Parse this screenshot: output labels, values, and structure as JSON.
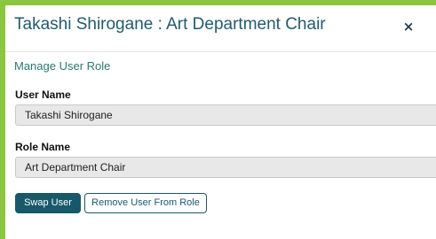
{
  "dialog": {
    "title": "Takashi Shirogane : Art Department Chair",
    "close_label": "×"
  },
  "section": {
    "title": "Manage User Role"
  },
  "fields": {
    "user_name": {
      "label": "User Name",
      "value": "Takashi Shirogane"
    },
    "role_name": {
      "label": "Role Name",
      "value": "Art Department Chair"
    }
  },
  "actions": {
    "swap_user_label": "Swap User",
    "remove_user_label": "Remove User From Role"
  },
  "colors": {
    "frame": "#8cc63f",
    "primary": "#17596b",
    "title_text": "#1f5c6e",
    "section_text": "#2a7a74",
    "input_bg": "#e8e8e8"
  },
  "icons": {
    "close": "close-icon"
  }
}
